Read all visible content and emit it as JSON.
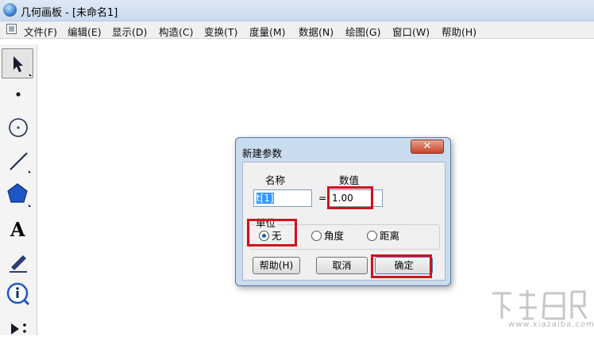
{
  "window": {
    "title": "几何画板 - [未命名1]"
  },
  "menu": [
    {
      "label": "文件(F)"
    },
    {
      "label": "编辑(E)"
    },
    {
      "label": "显示(D)"
    },
    {
      "label": "构造(C)"
    },
    {
      "label": "变换(T)"
    },
    {
      "label": "度量(M)"
    },
    {
      "label": "数据(N)"
    },
    {
      "label": "绘图(G)"
    },
    {
      "label": "窗口(W)"
    },
    {
      "label": "帮助(H)"
    }
  ],
  "toolbox": [
    {
      "icon": "arrow-select-icon"
    },
    {
      "icon": "point-icon"
    },
    {
      "icon": "compass-icon"
    },
    {
      "icon": "line-icon"
    },
    {
      "icon": "polygon-icon"
    },
    {
      "icon": "text-tool-icon"
    },
    {
      "icon": "marker-pen-icon"
    },
    {
      "icon": "info-icon"
    },
    {
      "icon": "custom-tool-icon"
    }
  ],
  "toolbox_text_glyph": "A",
  "dialog": {
    "title": "新建参数",
    "close_glyph": "✕",
    "name_label": "名称",
    "value_label": "数值",
    "name_value": "t[1]",
    "equals": "=",
    "number_value": "1.00",
    "unit_group_label": "单位",
    "units": [
      {
        "label": "无",
        "selected": true
      },
      {
        "label": "角度",
        "selected": false
      },
      {
        "label": "距离",
        "selected": false
      }
    ],
    "help_button": "帮助(H)",
    "cancel_button": "取消",
    "ok_button": "确定"
  },
  "watermark": {
    "text": "www.xiazaiba.com"
  },
  "colors": {
    "highlight": "#d0121b",
    "selection": "#3399ff"
  }
}
